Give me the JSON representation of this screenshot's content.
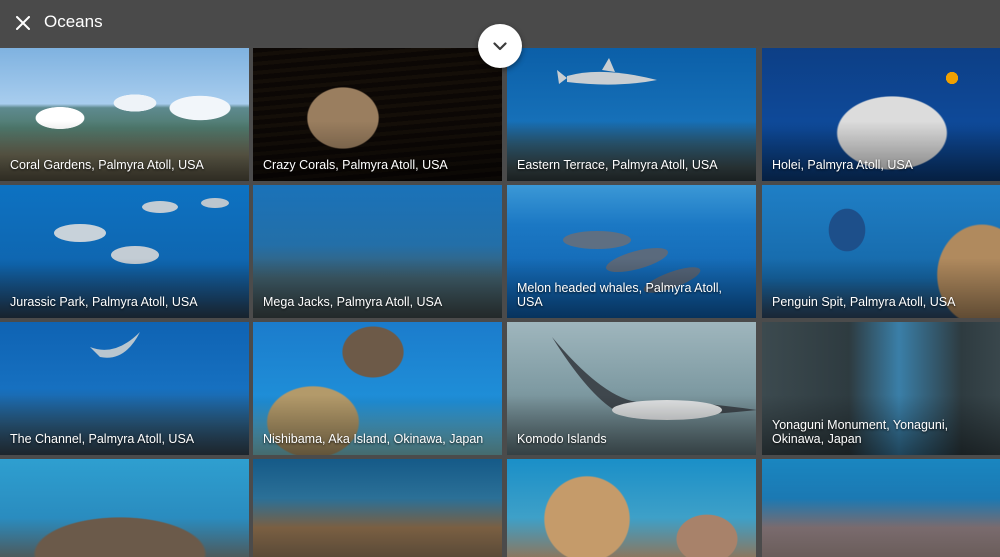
{
  "header": {
    "title": "Oceans",
    "close_icon": "close-icon",
    "expand_icon": "chevron-down-icon"
  },
  "colors": {
    "topbar": "#4a4a4a",
    "tile_gap": "#4b4b4b",
    "caption_text": "#ffffff",
    "expand_button": "#ffffff"
  },
  "tiles": [
    {
      "caption": "Coral Gardens, Palmyra Atoll, USA"
    },
    {
      "caption": "Crazy Corals, Palmyra Atoll, USA"
    },
    {
      "caption": "Eastern Terrace, Palmyra Atoll, USA"
    },
    {
      "caption": "Holei, Palmyra Atoll, USA"
    },
    {
      "caption": "Jurassic Park, Palmyra Atoll, USA"
    },
    {
      "caption": "Mega Jacks, Palmyra Atoll, USA"
    },
    {
      "caption": "Melon headed whales, Palmyra Atoll, USA"
    },
    {
      "caption": "Penguin Spit, Palmyra Atoll, USA"
    },
    {
      "caption": "The Channel, Palmyra Atoll, USA"
    },
    {
      "caption": "Nishibama, Aka Island, Okinawa, Japan"
    },
    {
      "caption": "Komodo Islands"
    },
    {
      "caption": "Yonaguni Monument, Yonaguni, Okinawa, Japan"
    },
    {
      "caption": ""
    },
    {
      "caption": ""
    },
    {
      "caption": ""
    },
    {
      "caption": ""
    }
  ]
}
